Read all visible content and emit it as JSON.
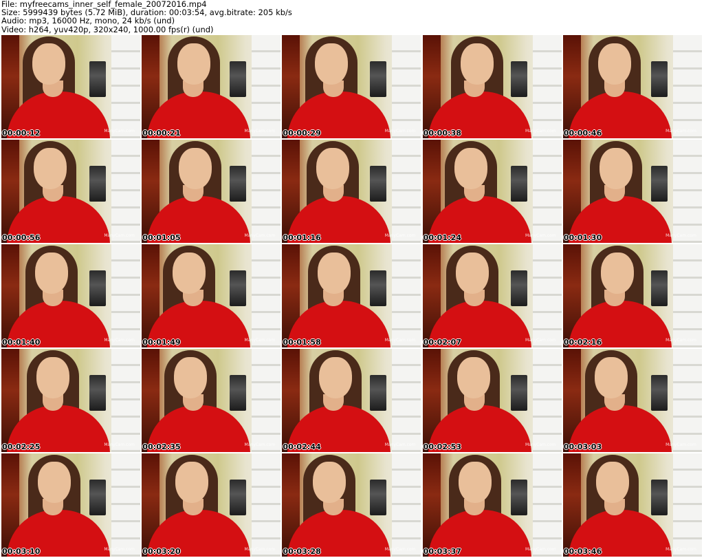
{
  "header": {
    "file": "File: myfreecams_inner_self_female_20072016.mp4",
    "size": "Size: 5999439 bytes (5.72 MiB), duration: 00:03:54, avg.bitrate: 205 kb/s",
    "audio": "Audio: mp3, 16000 Hz, mono, 24 kb/s (und)",
    "video": "Video: h264, yuv420p, 320x240, 1000.00 fps(r) (und)"
  },
  "watermark": "ManyCam.com",
  "thumbnails": [
    {
      "timestamp": "00:00:12"
    },
    {
      "timestamp": "00:00:21"
    },
    {
      "timestamp": "00:00:29"
    },
    {
      "timestamp": "00:00:38"
    },
    {
      "timestamp": "00:00:46"
    },
    {
      "timestamp": "00:00:56"
    },
    {
      "timestamp": "00:01:05"
    },
    {
      "timestamp": "00:01:16"
    },
    {
      "timestamp": "00:01:24"
    },
    {
      "timestamp": "00:01:30"
    },
    {
      "timestamp": "00:01:40"
    },
    {
      "timestamp": "00:01:49"
    },
    {
      "timestamp": "00:01:58"
    },
    {
      "timestamp": "00:02:07"
    },
    {
      "timestamp": "00:02:16"
    },
    {
      "timestamp": "00:02:25"
    },
    {
      "timestamp": "00:02:35"
    },
    {
      "timestamp": "00:02:44"
    },
    {
      "timestamp": "00:02:53"
    },
    {
      "timestamp": "00:03:03"
    },
    {
      "timestamp": "00:03:10"
    },
    {
      "timestamp": "00:03:20"
    },
    {
      "timestamp": "00:03:28"
    },
    {
      "timestamp": "00:03:37"
    },
    {
      "timestamp": "00:03:46"
    }
  ]
}
